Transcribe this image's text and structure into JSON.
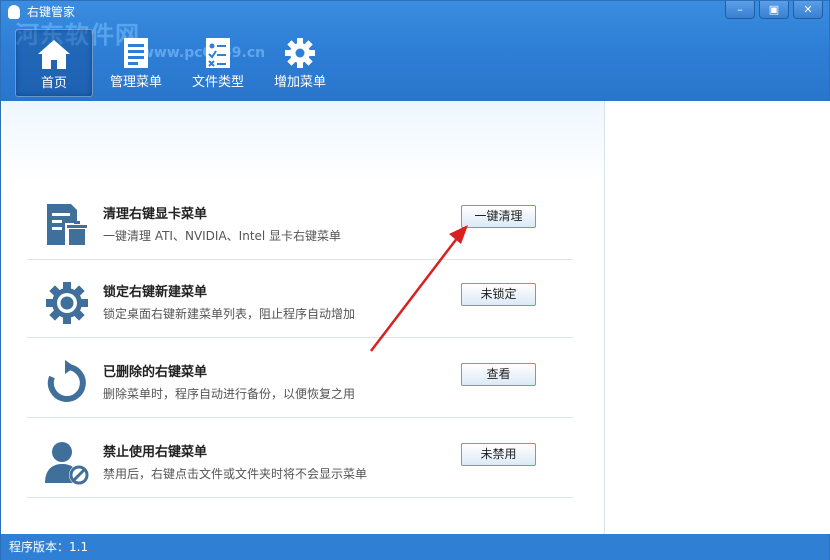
{
  "window": {
    "title": "右键管家",
    "controls": [
      "–",
      "▣",
      "✕"
    ]
  },
  "watermark": {
    "text": "河东软件网",
    "url": "www.pc0359.cn"
  },
  "nav": [
    {
      "label": "首页",
      "icon": "home-icon",
      "active": true
    },
    {
      "label": "管理菜单",
      "icon": "menu-list-icon",
      "active": false
    },
    {
      "label": "文件类型",
      "icon": "file-type-icon",
      "active": false
    },
    {
      "label": "增加菜单",
      "icon": "gear-icon",
      "active": false
    }
  ],
  "features": [
    {
      "title": "清理右键显卡菜单",
      "desc": "一键清理 ATI、NVIDIA、Intel 显卡右键菜单",
      "button": "一键清理",
      "icon": "document-delete-icon"
    },
    {
      "title": "锁定右键新建菜单",
      "desc": "锁定桌面右键新建菜单列表，阻止程序自动增加",
      "button": "未锁定",
      "icon": "gear-icon"
    },
    {
      "title": "已删除的右键菜单",
      "desc": "删除菜单时，程序自动进行备份，以便恢复之用",
      "button": "查看",
      "icon": "restore-icon"
    },
    {
      "title": "禁止使用右键菜单",
      "desc": "禁用后，右键点击文件或文件夹时将不会显示菜单",
      "button": "未禁用",
      "icon": "user-block-icon"
    }
  ],
  "status": {
    "text": "程序版本：1.1"
  },
  "colors": {
    "header": "#2e7fd6",
    "icon": "#3f6f9a",
    "arrow": "#e02020",
    "status": "#2f7fd4"
  }
}
